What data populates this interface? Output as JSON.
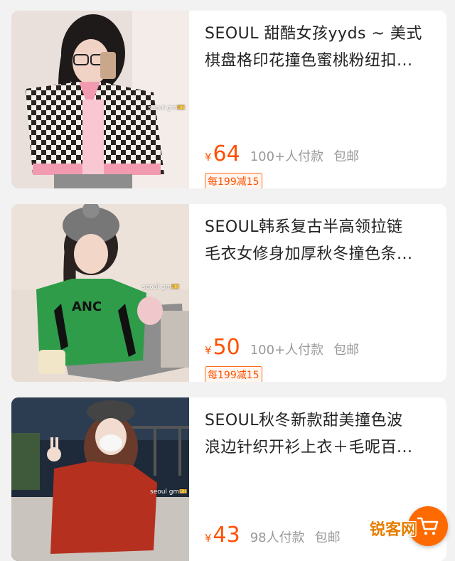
{
  "products": [
    {
      "title_line1": "SEOUL 甜酷女孩yyds ~ 美式",
      "title_line2": "棋盘格印花撞色蜜桃粉纽扣...",
      "currency": "¥",
      "price": "64",
      "sold": "100+人付款",
      "shipping": "包邮",
      "coupon": "每199减15",
      "image_watermark": "seoul gm🎫"
    },
    {
      "title_line1": "SEOUL韩系复古半高领拉链",
      "title_line2": "毛衣女修身加厚秋冬撞色条...",
      "currency": "¥",
      "price": "50",
      "sold": "100+人付款",
      "shipping": "包邮",
      "coupon": "每199减15",
      "image_watermark": "seoul gm🎫"
    },
    {
      "title_line1": "SEOUL秋冬新款甜美撞色波",
      "title_line2": "浪边针织开衫上衣＋毛呢百...",
      "currency": "¥",
      "price": "43",
      "sold": "98人付款",
      "shipping": "包邮",
      "image_watermark": "seoul gm🎫"
    }
  ],
  "cart_button_icon": "shopping-cart-icon",
  "site_watermark": "锐客网",
  "colors": {
    "price": "#ff5000",
    "fab": "#ff6a00",
    "background": "#f2f2f2"
  }
}
